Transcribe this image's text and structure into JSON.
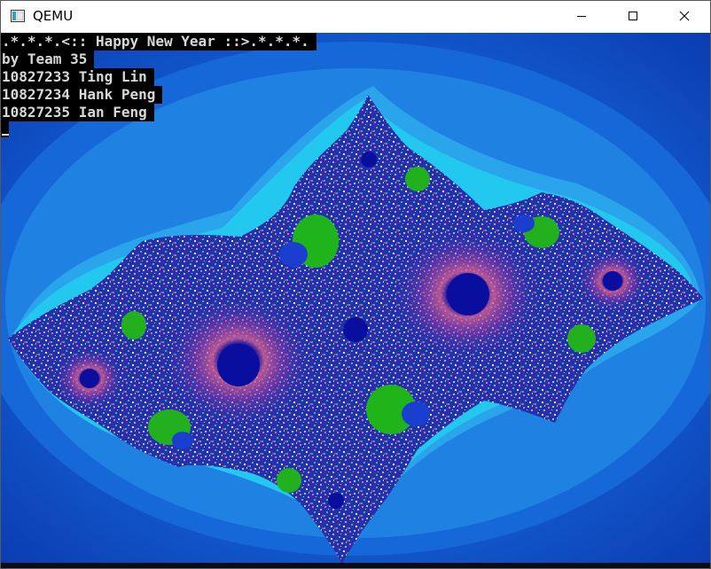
{
  "window": {
    "title": "QEMU",
    "icon": "qemu-app-icon",
    "controls": [
      "minimize-icon",
      "maximize-icon",
      "close-icon"
    ]
  },
  "console": {
    "lines": [
      ".*.*.*.<:: Happy New Year ::>.*.*.*.",
      "by Team 35",
      "10827233 Ting Lin",
      "10827234 Hank Peng",
      "10827235 Ian Feng"
    ]
  },
  "colors": {
    "background_dark_blue": "#0f3fb8",
    "halo_light_blue": "#27a0e8",
    "halo_cyan": "#1fd4ef",
    "fractal_green": "#22c61c",
    "fractal_navy": "#101aa0"
  }
}
